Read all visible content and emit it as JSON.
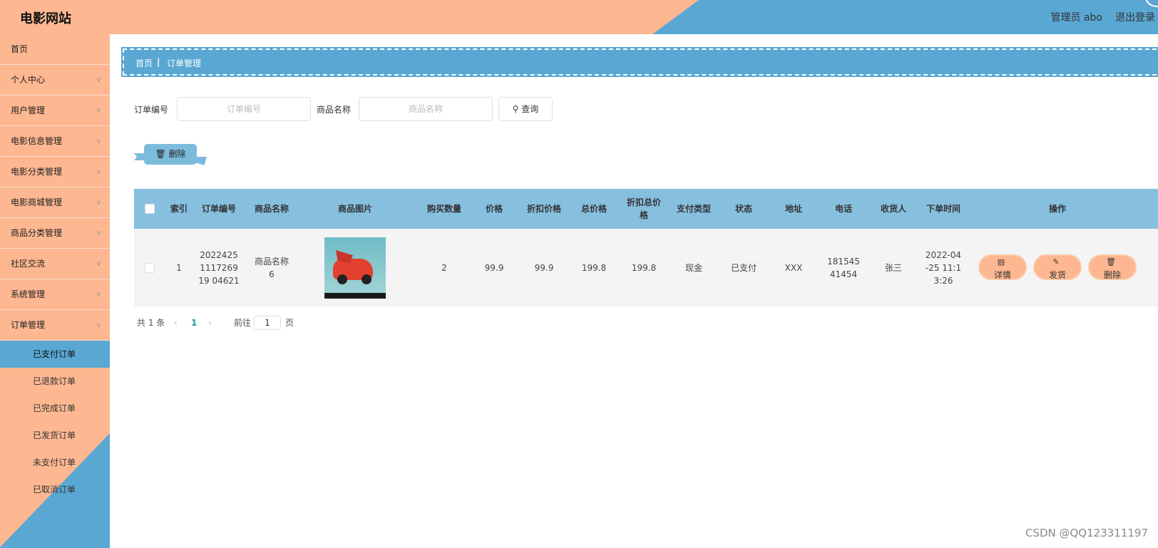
{
  "header": {
    "title": "电影网站",
    "admin_text": "管理员 abo",
    "logout": "退出登录"
  },
  "colors": {
    "peach": "#fdb791",
    "blue": "#5aa7d3",
    "table_header": "#87bfdf"
  },
  "sidebar": {
    "items": [
      {
        "label": "首页",
        "has_chevron": false
      },
      {
        "label": "个人中心",
        "has_chevron": true
      },
      {
        "label": "用户管理",
        "has_chevron": true
      },
      {
        "label": "电影信息管理",
        "has_chevron": true
      },
      {
        "label": "电影分类管理",
        "has_chevron": true
      },
      {
        "label": "电影商城管理",
        "has_chevron": true
      },
      {
        "label": "商品分类管理",
        "has_chevron": true
      },
      {
        "label": "社区交流",
        "has_chevron": true
      },
      {
        "label": "系统管理",
        "has_chevron": true
      },
      {
        "label": "订单管理",
        "has_chevron": true,
        "expanded": true
      }
    ],
    "sub_items": [
      {
        "label": "已支付订单",
        "active": true
      },
      {
        "label": "已退款订单",
        "active": false
      },
      {
        "label": "已完成订单",
        "active": false
      },
      {
        "label": "已发货订单",
        "active": false
      },
      {
        "label": "未支付订单",
        "active": false
      },
      {
        "label": "已取消订单",
        "active": false
      }
    ],
    "chevron_icon": "chevron-down-icon"
  },
  "breadcrumb": {
    "home": "首页",
    "separator": "|",
    "current": "订单管理"
  },
  "search": {
    "order_no_label": "订单编号",
    "order_no_placeholder": "订单编号",
    "product_name_label": "商品名称",
    "product_name_placeholder": "商品名称",
    "query_button": "查询",
    "query_icon": "search-icon"
  },
  "toolbar": {
    "delete_button": "删除",
    "delete_icon": "trash-icon"
  },
  "table": {
    "columns": [
      "索引",
      "订单编号",
      "商品名称",
      "商品图片",
      "购买数量",
      "价格",
      "折扣价格",
      "总价格",
      "折扣总价格",
      "支付类型",
      "状态",
      "地址",
      "电话",
      "收货人",
      "下单时间",
      "操作"
    ],
    "rows": [
      {
        "index": "1",
        "order_no": "2022425111726919 04621",
        "product_name": "商品名称6",
        "quantity": "2",
        "price": "99.9",
        "discount_price": "99.9",
        "total_price": "199.8",
        "discount_total": "199.8",
        "pay_type": "现金",
        "status": "已支付",
        "address": "XXX",
        "phone": "18154541454",
        "receiver": "张三",
        "order_time": "2022-04-25 11:13:26"
      }
    ],
    "actions": {
      "detail": "详情",
      "ship": "发货",
      "delete": "删除"
    }
  },
  "pagination": {
    "total_text": "共 1 条",
    "current_page": "1",
    "goto_label": "前往",
    "goto_value": "1",
    "page_suffix": "页"
  },
  "watermark": "CSDN @QQ123311197"
}
